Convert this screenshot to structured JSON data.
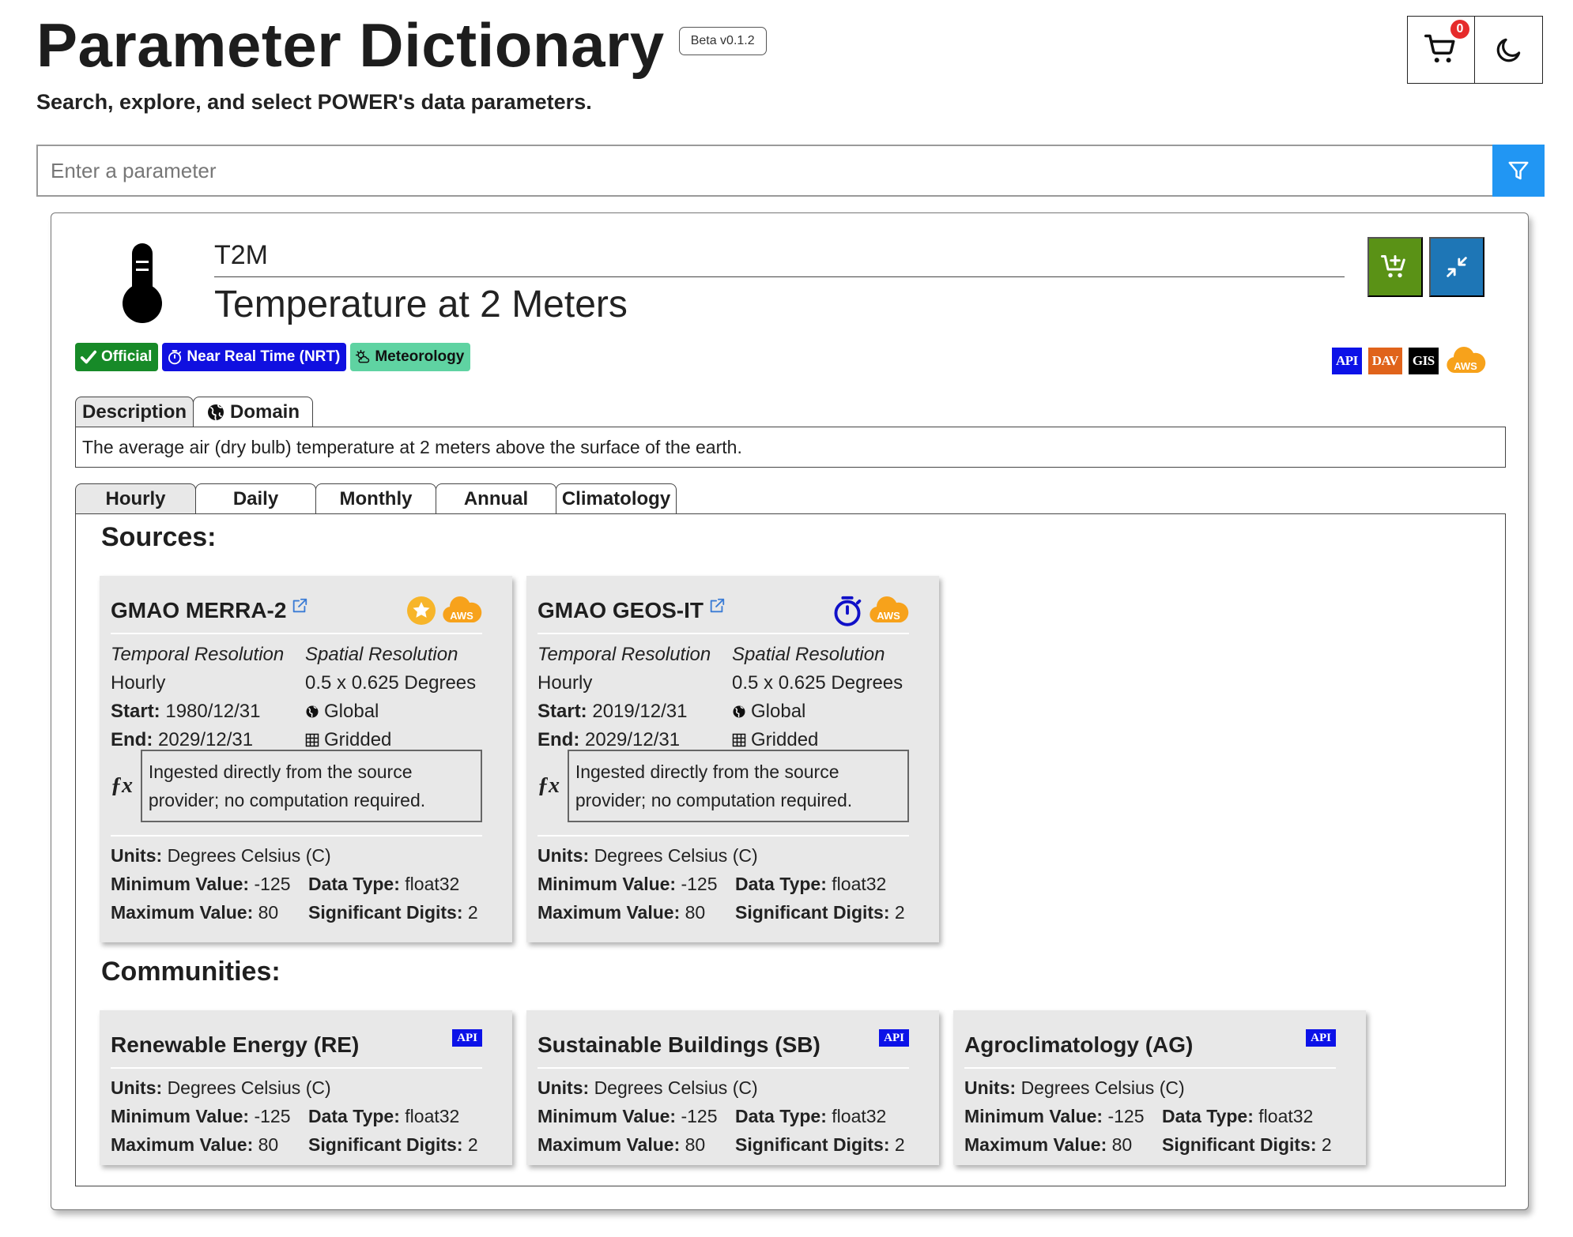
{
  "header": {
    "title": "Parameter Dictionary",
    "beta": "Beta v0.1.2",
    "subtitle": "Search, explore, and select POWER's data parameters.",
    "cart_count": "0"
  },
  "search": {
    "placeholder": "Enter a parameter"
  },
  "parameter": {
    "code": "T2M",
    "name": "Temperature at 2 Meters",
    "tags": [
      "Official",
      "Near Real Time (NRT)",
      "Meteorology"
    ],
    "access": [
      "API",
      "DAV",
      "GIS",
      "AWS"
    ],
    "desc_tabs": [
      "Description",
      "Domain"
    ],
    "description": "The average air (dry bulb) temperature at 2 meters above the surface of the earth.",
    "freq_tabs": [
      "Hourly",
      "Daily",
      "Monthly",
      "Annual",
      "Climatology"
    ],
    "active_freq": "Hourly"
  },
  "labels": {
    "sources": "Sources:",
    "communities": "Communities:",
    "temporal": "Temporal Resolution",
    "spatial": "Spatial Resolution",
    "start": "Start:",
    "end": "End:",
    "units": "Units:",
    "min": "Minimum Value:",
    "max": "Maximum Value:",
    "dtype": "Data Type:",
    "sig": "Significant Digits:",
    "aws": "AWS",
    "api": "API"
  },
  "sources": [
    {
      "name": "GMAO MERRA-2",
      "temporal": "Hourly",
      "spatial": "0.5 x 0.625 Degrees",
      "start": "1980/12/31",
      "end": "2029/12/31",
      "coverage": "Global",
      "grid": "Gridded",
      "calc": "Ingested directly from the source provider; no computation required.",
      "units": "Degrees Celsius (C)",
      "min": "-125",
      "max": "80",
      "dtype": "float32",
      "sig": "2"
    },
    {
      "name": "GMAO GEOS-IT",
      "temporal": "Hourly",
      "spatial": "0.5 x 0.625 Degrees",
      "start": "2019/12/31",
      "end": "2029/12/31",
      "coverage": "Global",
      "grid": "Gridded",
      "calc": "Ingested directly from the source provider; no computation required.",
      "units": "Degrees Celsius (C)",
      "min": "-125",
      "max": "80",
      "dtype": "float32",
      "sig": "2"
    }
  ],
  "communities": [
    {
      "name": "Renewable Energy (RE)",
      "units": "Degrees Celsius (C)",
      "min": "-125",
      "max": "80",
      "dtype": "float32",
      "sig": "2"
    },
    {
      "name": "Sustainable Buildings (SB)",
      "units": "Degrees Celsius (C)",
      "min": "-125",
      "max": "80",
      "dtype": "float32",
      "sig": "2"
    },
    {
      "name": "Agroclimatology (AG)",
      "units": "Degrees Celsius (C)",
      "min": "-125",
      "max": "80",
      "dtype": "float32",
      "sig": "2"
    }
  ],
  "colors": {
    "filter": "#2196f3",
    "add_cart": "#5a9216",
    "collapse": "#1e76b6",
    "official": "#178a28",
    "nrt": "#1010e0",
    "meteorology": "#5fd3a2",
    "aws_orange": "#f7a21b",
    "api_blue": "#0c12e8",
    "dav_orange": "#e0631b",
    "card_bg": "#e8e8e8"
  },
  "icons": {
    "cart": "cart-icon",
    "theme": "moon-icon",
    "filter": "filter-icon",
    "parameter": "thermometer-icon",
    "add": "cart-plus-icon",
    "collapse": "collapse-arrows-icon",
    "official": "check-icon",
    "nrt": "stopwatch-icon",
    "meteorology": "weather-icon",
    "domain": "globe-icon",
    "external": "external-link-icon",
    "merra_star": "star-icon",
    "geos_timer": "stopwatch-icon",
    "calc": "function-icon",
    "coverage": "globe-icon",
    "grid": "grid-icon"
  }
}
